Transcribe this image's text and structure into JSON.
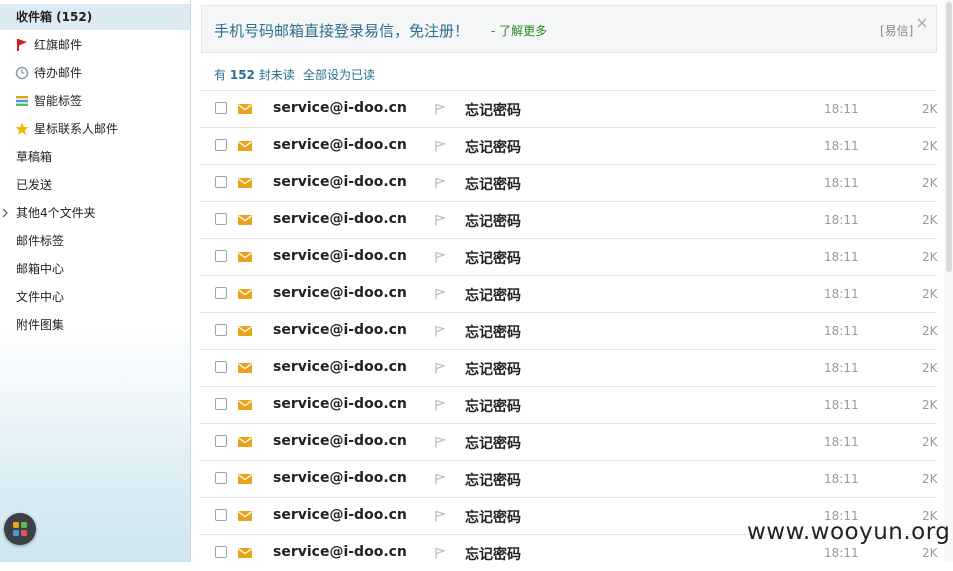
{
  "sidebar": {
    "items": [
      {
        "label": "收件箱 (152)",
        "active": true
      },
      {
        "label": "红旗邮件",
        "icon": "red-flag-icon"
      },
      {
        "label": "待办邮件",
        "icon": "clock-icon"
      },
      {
        "label": "智能标签",
        "icon": "tag-stripes-icon"
      },
      {
        "label": "星标联系人邮件",
        "icon": "star-icon"
      },
      {
        "label": "草稿箱"
      },
      {
        "label": "已发送"
      },
      {
        "label": "其他4个文件夹",
        "icon": "chevron-right-icon"
      },
      {
        "label": "邮件标签"
      },
      {
        "label": "邮箱中心"
      },
      {
        "label": "文件中心"
      },
      {
        "label": "附件图集"
      }
    ],
    "apps_icon": "app-grid-icon"
  },
  "banner": {
    "text": "手机号码邮箱直接登录易信，免注册！",
    "link": "- 了解更多",
    "tag": "[易信]",
    "close_icon": "close-icon"
  },
  "summary": {
    "prefix": "有",
    "count": "152",
    "suffix": "封未读",
    "mark_all": "全部设为已读"
  },
  "emails": [
    {
      "sender": "service@i-doo.cn",
      "subject": "忘记密码",
      "time": "18:11",
      "size": "2K"
    },
    {
      "sender": "service@i-doo.cn",
      "subject": "忘记密码",
      "time": "18:11",
      "size": "2K"
    },
    {
      "sender": "service@i-doo.cn",
      "subject": "忘记密码",
      "time": "18:11",
      "size": "2K"
    },
    {
      "sender": "service@i-doo.cn",
      "subject": "忘记密码",
      "time": "18:11",
      "size": "2K"
    },
    {
      "sender": "service@i-doo.cn",
      "subject": "忘记密码",
      "time": "18:11",
      "size": "2K"
    },
    {
      "sender": "service@i-doo.cn",
      "subject": "忘记密码",
      "time": "18:11",
      "size": "2K"
    },
    {
      "sender": "service@i-doo.cn",
      "subject": "忘记密码",
      "time": "18:11",
      "size": "2K"
    },
    {
      "sender": "service@i-doo.cn",
      "subject": "忘记密码",
      "time": "18:11",
      "size": "2K"
    },
    {
      "sender": "service@i-doo.cn",
      "subject": "忘记密码",
      "time": "18:11",
      "size": "2K"
    },
    {
      "sender": "service@i-doo.cn",
      "subject": "忘记密码",
      "time": "18:11",
      "size": "2K"
    },
    {
      "sender": "service@i-doo.cn",
      "subject": "忘记密码",
      "time": "18:11",
      "size": "2K"
    },
    {
      "sender": "service@i-doo.cn",
      "subject": "忘记密码",
      "time": "18:11",
      "size": "2K"
    },
    {
      "sender": "service@i-doo.cn",
      "subject": "忘记密码",
      "time": "18:11",
      "size": "2K"
    }
  ],
  "colors": {
    "accent": "#2a6f8e",
    "link_green": "#2a8a1e",
    "envelope": "#e8a21c",
    "flag_red": "#d21e1e",
    "star": "#f5b400",
    "active_bg": "#dcebf3"
  },
  "watermark": "www.wooyun.org"
}
